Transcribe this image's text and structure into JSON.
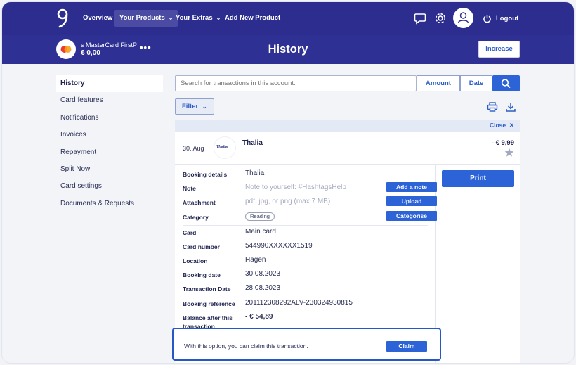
{
  "nav": {
    "items": [
      {
        "label": "Overview",
        "active": false,
        "dropdown": false
      },
      {
        "label": "Your Products",
        "active": true,
        "dropdown": true
      },
      {
        "label": "Your Extras",
        "active": false,
        "dropdown": true
      },
      {
        "label": "Add New Product",
        "active": false,
        "dropdown": false
      }
    ],
    "icons": [
      "chat-icon",
      "gear-icon",
      "avatar"
    ],
    "logout_label": "Logout"
  },
  "header": {
    "card_name": "s MasterCard FirstP",
    "card_balance": "€ 0,00",
    "more_label": "•••",
    "title": "History",
    "increase_label": "Increase"
  },
  "sidebar": {
    "items": [
      {
        "label": "History",
        "active": true
      },
      {
        "label": "Card features",
        "active": false
      },
      {
        "label": "Notifications",
        "active": false
      },
      {
        "label": "Invoices",
        "active": false
      },
      {
        "label": "Repayment",
        "active": false
      },
      {
        "label": "Split Now",
        "active": false
      },
      {
        "label": "Card settings",
        "active": false
      },
      {
        "label": "Documents & Requests",
        "active": false
      }
    ]
  },
  "search": {
    "placeholder": "Search for transactions in this account.",
    "amount_label": "Amount",
    "date_label": "Date"
  },
  "filter_label": "Filter",
  "transaction": {
    "close_label": "Close",
    "date": "30. Aug",
    "merchant_logo_text": "Thalia",
    "merchant": "Thalia",
    "amount": "- € 9,99",
    "details": [
      {
        "label": "Booking details",
        "value": "Thalia"
      },
      {
        "label": "Note",
        "placeholder": "Note to yourself: #HashtagsHelp",
        "action": "Add a note"
      },
      {
        "label": "Attachment",
        "placeholder": "pdf, jpg, or png (max 7 MB)",
        "action": "Upload"
      },
      {
        "label": "Category",
        "pill": "Reading",
        "action": "Categorise"
      },
      {
        "label": "Card",
        "value": "Main card"
      },
      {
        "label": "Card number",
        "value": "544990XXXXXX1519"
      },
      {
        "label": "Location",
        "value": "Hagen"
      },
      {
        "label": "Booking date",
        "value": "30.08.2023"
      },
      {
        "label": "Transaction Date",
        "value": "28.08.2023"
      },
      {
        "label": "Booking reference",
        "value": "201112308292ALV-230324930815"
      },
      {
        "label": "Balance after this transaction",
        "value": "- € 54,89"
      }
    ],
    "print_label": "Print"
  },
  "claim": {
    "text": "With this option, you can claim this transaction.",
    "button_label": "Claim"
  },
  "colors": {
    "nav_bg": "#2d2d8f",
    "accent": "#2c63d6",
    "claim_border": "#2657c9"
  }
}
